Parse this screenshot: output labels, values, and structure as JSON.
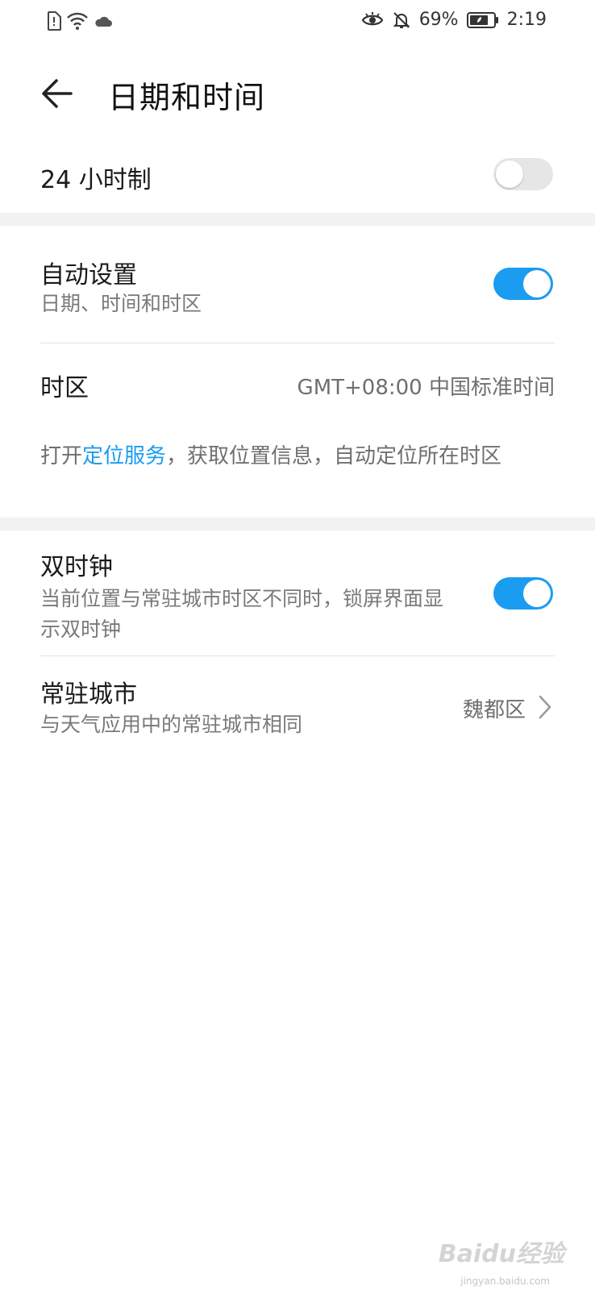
{
  "status_bar": {
    "battery": "69%",
    "time": "2:19"
  },
  "header": {
    "title": "日期和时间"
  },
  "hour24": {
    "label": "24 小时制",
    "enabled": false
  },
  "auto": {
    "label": "自动设置",
    "sub": "日期、时间和时区",
    "enabled": true
  },
  "timezone": {
    "label": "时区",
    "value": "GMT+08:00 中国标准时间"
  },
  "hint": {
    "prefix": "打开",
    "link": "定位服务",
    "suffix": "，获取位置信息，自动定位所在时区"
  },
  "dual_clock": {
    "label": "双时钟",
    "sub": "当前位置与常驻城市时区不同时，锁屏界面显示双时钟",
    "enabled": true
  },
  "home_city": {
    "label": "常驻城市",
    "sub": "与天气应用中的常驻城市相同",
    "value": "魏都区"
  },
  "watermark": {
    "logo": "Baidu经验",
    "url": "jingyan.baidu.com"
  },
  "colors": {
    "accent": "#1a9cf0",
    "toggle_off": "#e6e6e6",
    "band": "#f2f2f2"
  }
}
